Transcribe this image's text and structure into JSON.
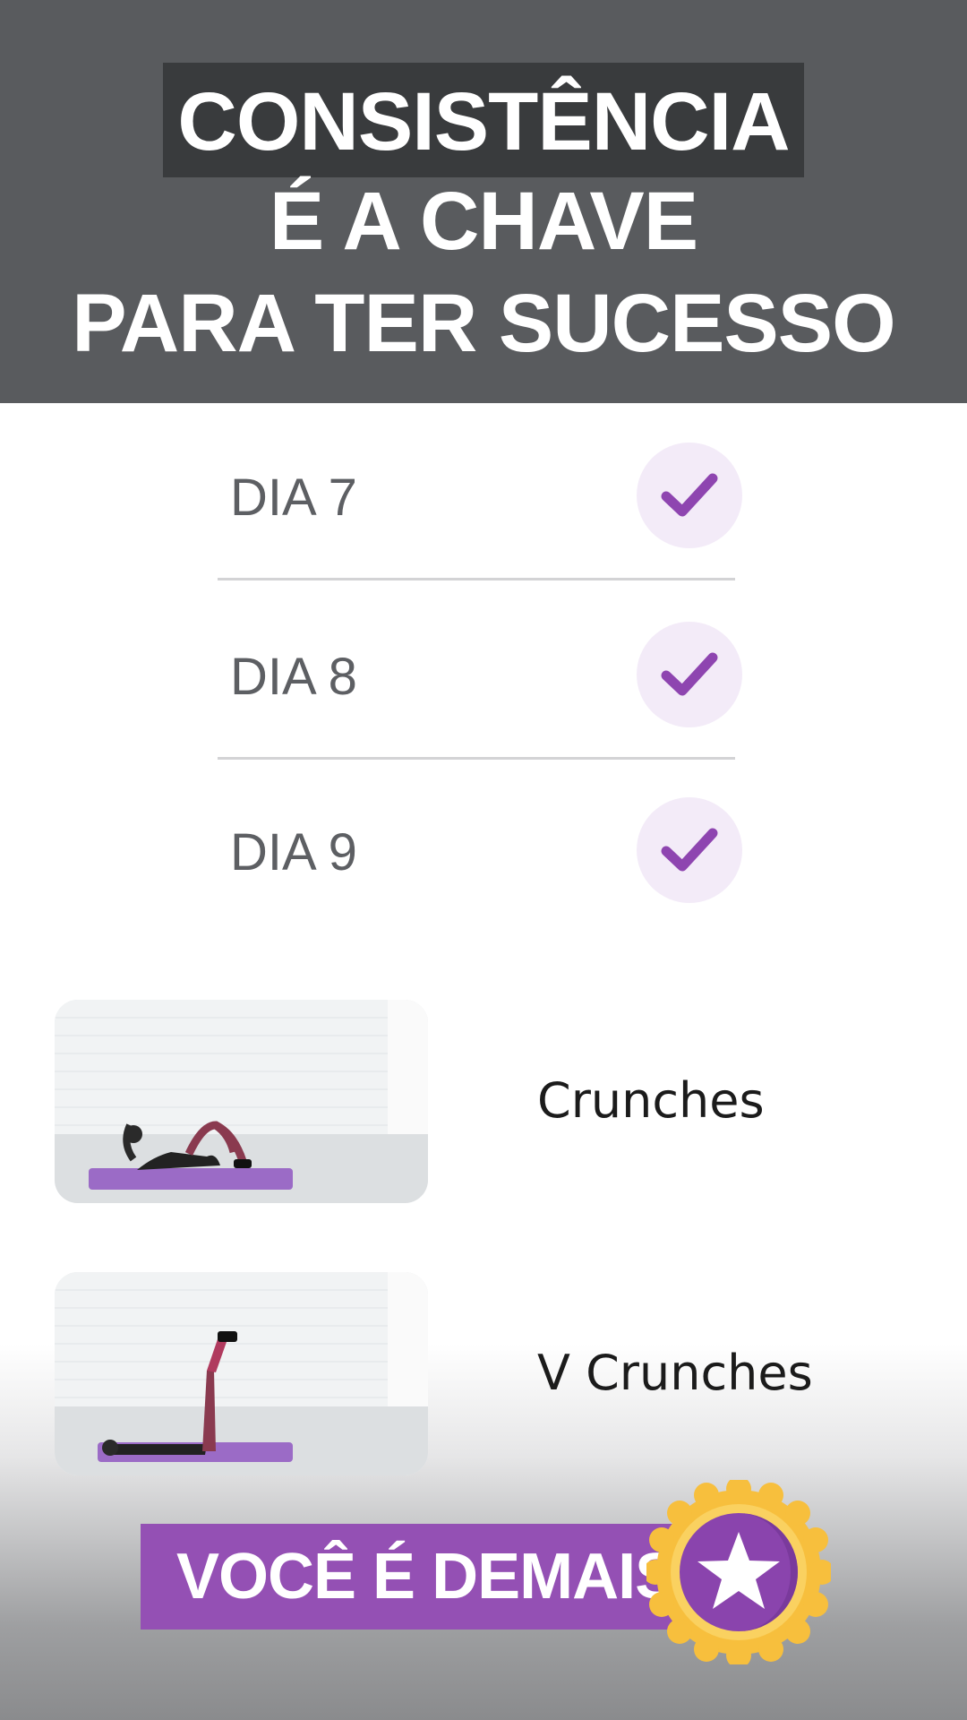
{
  "header": {
    "line1": "CONSISTÊNCIA",
    "line2": "É A CHAVE",
    "line3": "PARA TER SUCESSO"
  },
  "days": [
    {
      "label": "DIA 7",
      "completed": true
    },
    {
      "label": "DIA 8",
      "completed": true
    },
    {
      "label": "DIA 9",
      "completed": true
    }
  ],
  "exercises": [
    {
      "name": "Crunches"
    },
    {
      "name": "V Crunches"
    }
  ],
  "banner": {
    "text": "VOCÊ É DEMAIS",
    "badge_icon": "star-medal-icon"
  },
  "colors": {
    "header_bg": "#595b5e",
    "header_highlight": "#393b3d",
    "accent_purple": "#9450b4",
    "check_bg": "#f3ebf8",
    "medal_gold": "#f7bf3d"
  }
}
